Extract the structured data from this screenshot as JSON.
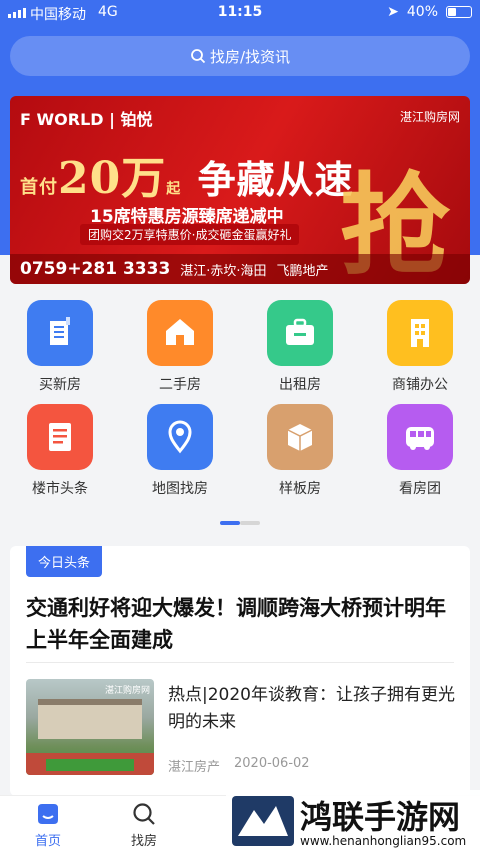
{
  "status_bar": {
    "carrier": "中国移动",
    "network": "4G",
    "time": "11:15",
    "battery": "40%",
    "battery_level": 0.4
  },
  "search": {
    "label": "找房/找资讯"
  },
  "banner": {
    "brand": "F WORLD | 铂悦",
    "site": "湛江购房网",
    "headline_prefix": "首付",
    "headline_amount": "20万",
    "headline_suffix": "起",
    "headline_slogan": "争藏从速",
    "big_char": "抢",
    "line1": "15席特惠房源臻席递减中",
    "line2": "团购交2万享特惠价·成交砸金蛋赢好礼",
    "phone": "0759+281 3333",
    "locations": "湛江·赤坎·海田",
    "developer": "飞鹏地产"
  },
  "grid": [
    {
      "label": "买新房",
      "icon": "new-house-icon",
      "color": "#3f7cf1"
    },
    {
      "label": "二手房",
      "icon": "house-icon",
      "color": "#ff8a2a"
    },
    {
      "label": "出租房",
      "icon": "suitcase-icon",
      "color": "#35c98a"
    },
    {
      "label": "商铺办公",
      "icon": "office-building-icon",
      "color": "#ffbf1f"
    },
    {
      "label": "楼市头条",
      "icon": "news-icon",
      "color": "#f4553f"
    },
    {
      "label": "地图找房",
      "icon": "map-pin-icon",
      "color": "#3f7cf1"
    },
    {
      "label": "样板房",
      "icon": "box-icon",
      "color": "#d8a06e"
    },
    {
      "label": "看房团",
      "icon": "bus-icon",
      "color": "#b65cf0"
    }
  ],
  "news_card": {
    "tag": "今日头条",
    "headline": "交通利好将迎大爆发！调顺跨海大桥预计明年上半年全面建成",
    "article": {
      "title": "热点|2020年谈教育：让孩子拥有更光明的未来",
      "source": "湛江房产",
      "date": "2020-06-02",
      "thumb_caption": "湛江购房网"
    }
  },
  "tabbar": {
    "home": "首页",
    "find_house": "找房"
  },
  "watermark": {
    "name": "鸿联手游网",
    "url": "www.henanhonglian95.com"
  },
  "colors": {
    "primary": "#3d6ff0",
    "banner_red": "#c8141a",
    "gold": "#f7c85a"
  }
}
